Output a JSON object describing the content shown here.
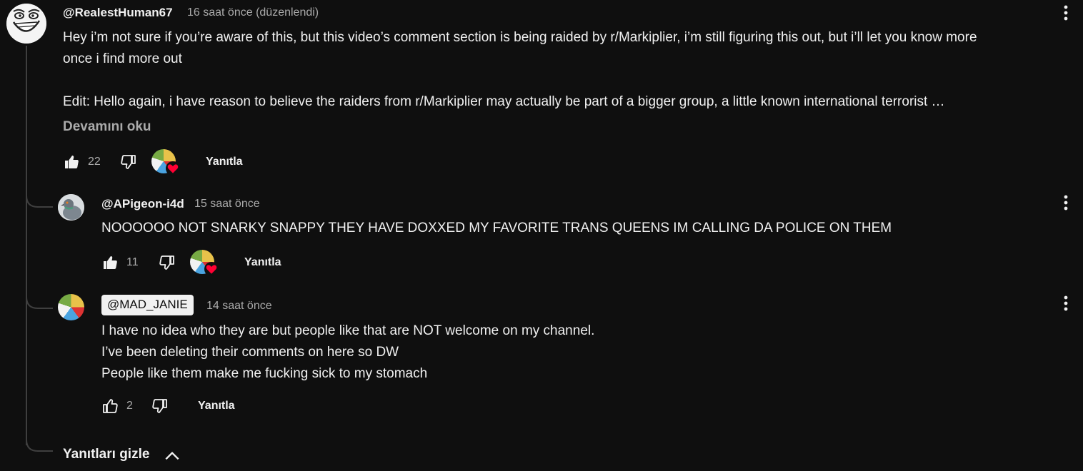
{
  "comments": [
    {
      "handle": "@RealestHuman67",
      "time": "16 saat önce (düzenlendi)",
      "avatar_icon": "trollface-avatar",
      "lines": [
        "Hey i’m not sure if you’re aware of this, but this video’s comment section is being raided by r/Markiplier, i’m still figuring this out, but i’ll let you know more",
        "once i find more out",
        "",
        "Edit: Hello again, i have reason to believe the raiders from r/Markiplier may actually be part of a bigger group, a little known international terrorist …"
      ],
      "read_more": "Devamını oku",
      "likes": "22",
      "creator_heart": true,
      "reply_label": "Yanıtla"
    },
    {
      "handle": "@APigeon-i4d",
      "time": "15 saat önce",
      "avatar_icon": "pigeon-avatar",
      "lines": [
        "NOOOOOO NOT SNARKY SNAPPY THEY HAVE DOXXED MY FAVORITE TRANS QUEENS IM CALLING DA POLICE ON THEM"
      ],
      "likes": "11",
      "creator_heart": true,
      "reply_label": "Yanıtla"
    },
    {
      "handle": "@MAD_JANIE",
      "is_creator": true,
      "time": "14 saat önce",
      "avatar_icon": "creator-avatar",
      "lines": [
        "I have no idea who they are but people like that are NOT welcome on my channel.",
        "I’ve been deleting their comments on here so DW",
        "People like them make me fucking sick to my stomach"
      ],
      "likes": "2",
      "creator_heart": false,
      "reply_label": "Yanıtla"
    }
  ],
  "hide_replies_label": "Yanıtları gizle",
  "colors": {
    "background": "#0f0f0f",
    "text": "#f1f1f1",
    "muted": "#aaaaaa",
    "heart": "#ff0033",
    "thread_line": "#3f3f3f"
  }
}
